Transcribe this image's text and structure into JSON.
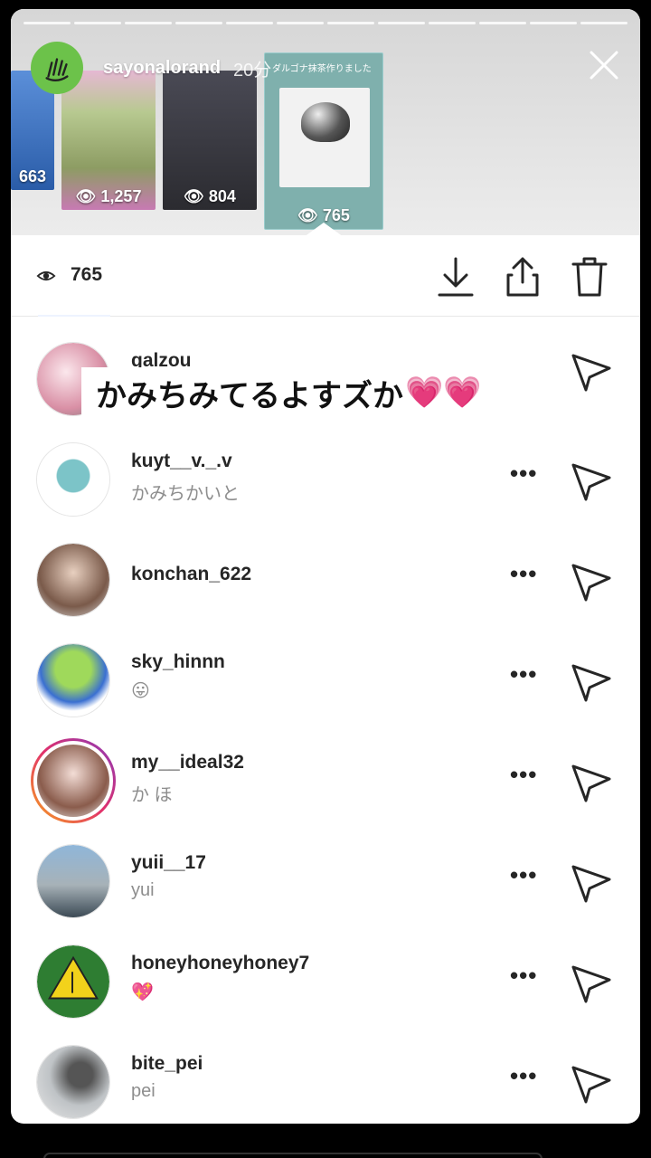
{
  "header": {
    "username": "sayonalorand",
    "time": "20分"
  },
  "thumbnails": [
    {
      "views": "663"
    },
    {
      "views": "1,257"
    },
    {
      "views": "804"
    },
    {
      "views": "765",
      "caption": "ダルゴナ抹茶作りました"
    }
  ],
  "toolbar": {
    "view_count": "765",
    "icons": [
      "download-icon",
      "share-icon",
      "trash-icon"
    ]
  },
  "overlay_text": {
    "text": "かみちみてるよすズか",
    "hearts": "💗💗"
  },
  "viewers": [
    {
      "username": "galzou",
      "subtitle": "",
      "send_icon": "send-icon"
    },
    {
      "username": "kuyt__v._.v",
      "subtitle": "かみちかいと",
      "more": "•••"
    },
    {
      "username": "konchan_622",
      "subtitle": "",
      "more": "•••"
    },
    {
      "username": "sky_hinnn",
      "subtitle": "😛",
      "more": "•••"
    },
    {
      "username": "my__ideal32",
      "subtitle": "か ほ",
      "more": "•••"
    },
    {
      "username": "yuii__17",
      "subtitle": "yui",
      "more": "•••"
    },
    {
      "username": "honeyhoneyhoney7",
      "subtitle": "💖",
      "more": "•••"
    },
    {
      "username": "bite_pei",
      "subtitle": "pei",
      "more": "•••"
    }
  ],
  "colors": {
    "accent_ring": "#e1306c",
    "text": "#262626",
    "subtext": "#8e8e8e"
  }
}
